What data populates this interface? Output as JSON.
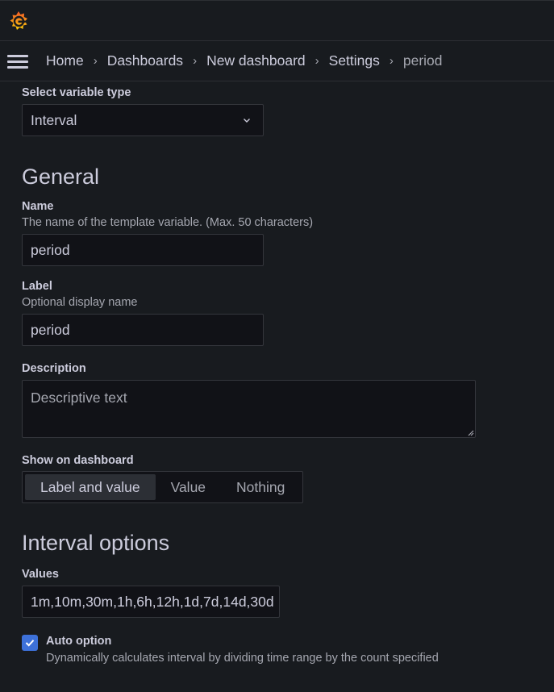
{
  "app": {
    "logo": "grafana-logo"
  },
  "nav": {
    "menu_icon": "hamburger-menu-icon",
    "breadcrumb": [
      "Home",
      "Dashboards",
      "New dashboard",
      "Settings",
      "period"
    ],
    "separator": "›"
  },
  "variable_type": {
    "label": "Select variable type",
    "value": "Interval"
  },
  "general": {
    "title": "General",
    "name": {
      "label": "Name",
      "description": "The name of the template variable. (Max. 50 characters)",
      "value": "period"
    },
    "display_label": {
      "label": "Label",
      "description": "Optional display name",
      "value": "period"
    },
    "description": {
      "label": "Description",
      "placeholder": "Descriptive text",
      "value": ""
    },
    "show_on_dashboard": {
      "label": "Show on dashboard",
      "options": [
        "Label and value",
        "Value",
        "Nothing"
      ],
      "selected": "Label and value"
    }
  },
  "interval_options": {
    "title": "Interval options",
    "values": {
      "label": "Values",
      "value": "1m,10m,30m,1h,6h,12h,1d,7d,14d,30d"
    },
    "auto_option": {
      "label": "Auto option",
      "checked": true,
      "description": "Dynamically calculates interval by dividing time range by the count specified"
    }
  },
  "colors": {
    "accent": "#3d71d9",
    "logo": "#f46800"
  }
}
